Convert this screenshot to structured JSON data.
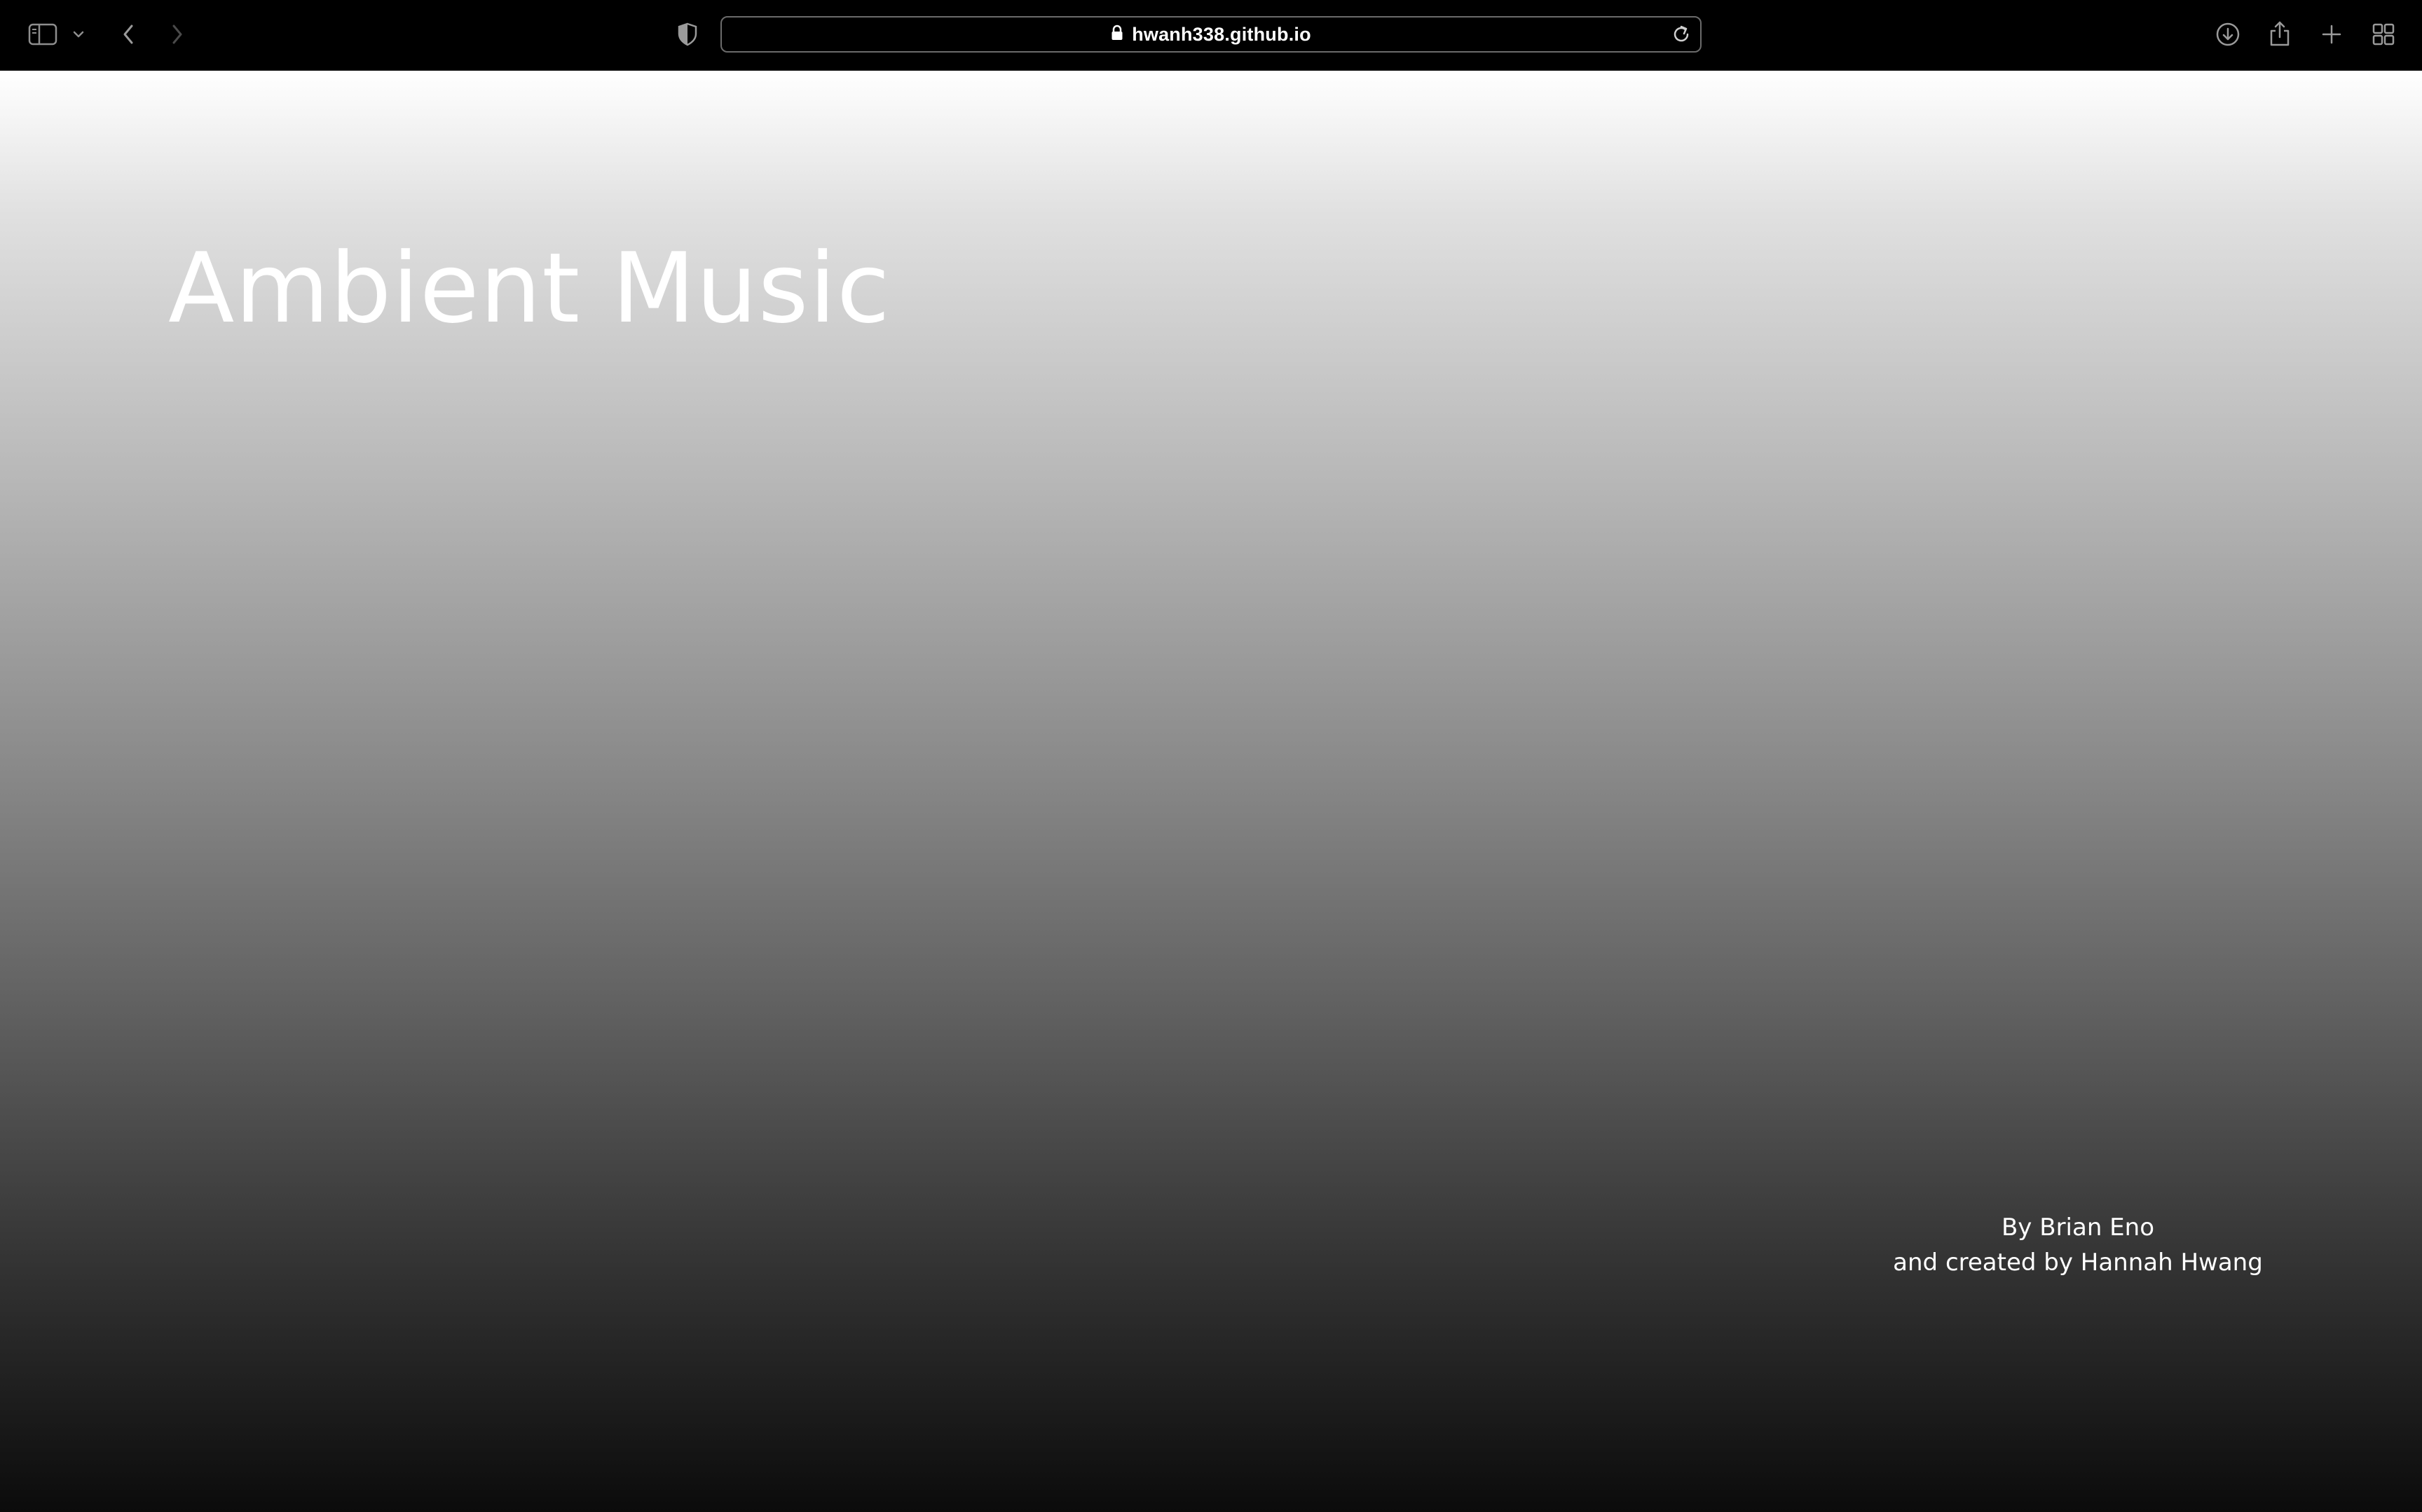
{
  "browser": {
    "url": "hwanh338.github.io",
    "icons": {
      "sidebar": "sidebar-icon",
      "sidebar_menu": "chevron-down-icon",
      "back": "chevron-left-icon",
      "forward": "chevron-right-icon",
      "privacy": "shield-icon",
      "lock": "lock-icon",
      "reload": "reload-icon",
      "downloads": "download-icon",
      "share": "share-icon",
      "new_tab": "plus-icon",
      "tab_overview": "grid-icon"
    }
  },
  "page": {
    "title": "Ambient Music",
    "credit_line_1": "By Brian Eno",
    "credit_line_2": "and created by Hannah Hwang"
  },
  "colors": {
    "toolbar_bg": "#000000",
    "gradient_top": "#ffffff",
    "gradient_bottom": "#0b0b0b",
    "text": "#ffffff"
  }
}
